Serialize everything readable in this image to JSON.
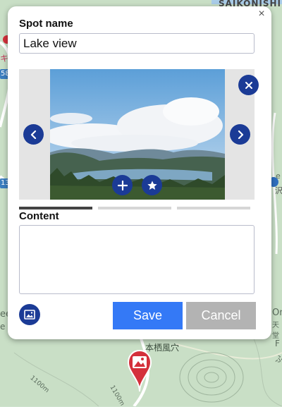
{
  "map": {
    "labels": {
      "saikonishi": "SAIKONISHI",
      "kana": "キ",
      "route58": "58",
      "route13": "13",
      "jp_marsh": "沢",
      "jp_hole": "本栖風穴",
      "jp_small": "天堂",
      "contour1": "1100m",
      "contour2": "1100m",
      "om": "Om",
      "ee": "ee",
      "e1": "e",
      "e2": "e",
      "fu": "F",
      "fu2": "ふ"
    },
    "colors": {
      "land": "#c9dfc6",
      "road": "#ffffff",
      "route_shield": "#3b7ebf",
      "marker": "#d4303b"
    }
  },
  "dialog": {
    "close_label": "×",
    "spot_name_label": "Spot name",
    "spot_name_value": "Lake view",
    "content_label": "Content",
    "content_value": "",
    "save_label": "Save",
    "cancel_label": "Cancel",
    "tabs": {
      "count": 3,
      "active_index": 0
    },
    "icons": {
      "close": "close-icon",
      "prev": "chevron-left-icon",
      "next": "chevron-right-icon",
      "delete_photo": "close-circle-icon",
      "add_photo": "plus-icon",
      "set_cover": "star-icon",
      "image_picker": "image-icon"
    },
    "colors": {
      "accent": "#1b3b96",
      "save": "#3479f6",
      "cancel": "#b3b3b3"
    }
  }
}
